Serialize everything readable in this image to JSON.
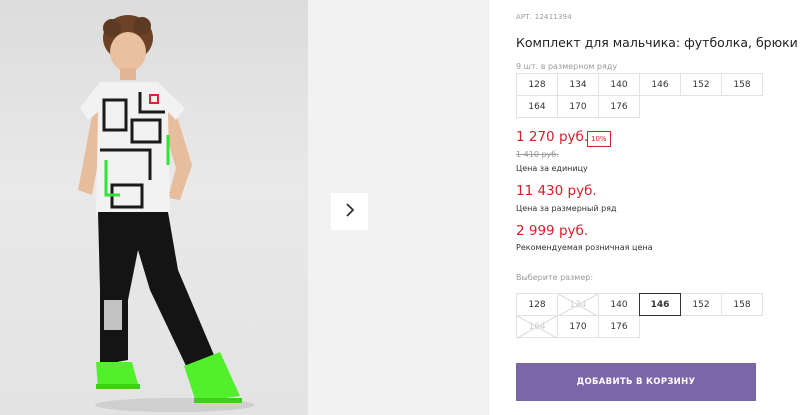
{
  "product": {
    "article": "АРТ. 12411394",
    "title": "Комплект для мальчика: футболка, брюки",
    "image_alt": "Boy wearing printed t-shirt and black joggers"
  },
  "size_row": {
    "caption": "9 шт. в размерном ряду",
    "sizes": [
      "128",
      "134",
      "140",
      "146",
      "152",
      "158",
      "164",
      "170",
      "176"
    ]
  },
  "prices": {
    "price": "1 270 руб.",
    "discount": "10%",
    "old_price": "1 410 руб.",
    "unit_caption": "Цена за единицу",
    "row_price": "11 430 руб.",
    "row_caption": "Цена за размерный ряд",
    "recommended_price": "2 999 руб.",
    "recommended_caption": "Рекомендуемая розничная цена"
  },
  "size_picker": {
    "caption": "Выберите размер:",
    "sizes": [
      {
        "label": "128",
        "state": "available"
      },
      {
        "label": "134",
        "state": "disabled"
      },
      {
        "label": "140",
        "state": "available"
      },
      {
        "label": "146",
        "state": "selected"
      },
      {
        "label": "152",
        "state": "available"
      },
      {
        "label": "158",
        "state": "available"
      },
      {
        "label": "164",
        "state": "disabled"
      },
      {
        "label": "170",
        "state": "available"
      },
      {
        "label": "176",
        "state": "available"
      }
    ],
    "selected": "146"
  },
  "actions": {
    "add_to_cart": "ДОБАВИТЬ В КОРЗИНУ"
  },
  "colors": {
    "accent": "#7b66a8",
    "price_red": "#d4202a"
  },
  "icons": {
    "next": "chevron-right-icon"
  }
}
